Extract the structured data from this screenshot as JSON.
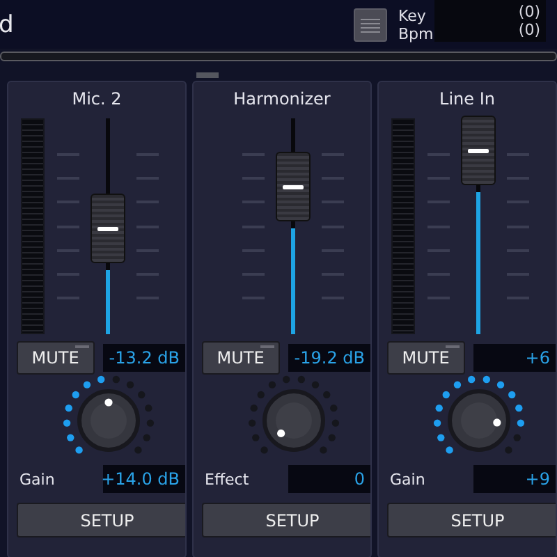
{
  "header": {
    "title": "d",
    "key_label": "Key",
    "key_value": "(0)",
    "bpm_label": "Bpm",
    "bpm_value": "(0)"
  },
  "channels": [
    {
      "name": "Mic. 2",
      "meter": true,
      "level": 0.31,
      "mute_label": "MUTE",
      "muted": false,
      "reading": "-13.2 dB",
      "knob_dots": [
        {
          "on": true
        },
        {
          "on": true
        },
        {
          "on": true
        },
        {
          "on": true
        },
        {
          "on": true
        },
        {
          "on": true
        },
        {
          "on": true
        },
        {
          "on": false
        },
        {
          "on": false
        },
        {
          "on": false
        },
        {
          "on": false
        },
        {
          "on": false
        },
        {
          "on": false
        },
        {
          "on": false
        }
      ],
      "knob_label": "Gain",
      "knob_reading": "+14.0 dB",
      "setup_label": "SETUP"
    },
    {
      "name": "Harmonizer",
      "meter": false,
      "level": 0.51,
      "mute_label": "MUTE",
      "muted": false,
      "reading": "-19.2 dB",
      "knob_dots": [
        {
          "on": false
        },
        {
          "on": false
        },
        {
          "on": false
        },
        {
          "on": false
        },
        {
          "on": false
        },
        {
          "on": false
        },
        {
          "on": false
        },
        {
          "on": false
        },
        {
          "on": false
        },
        {
          "on": false
        },
        {
          "on": false
        },
        {
          "on": false
        },
        {
          "on": false
        },
        {
          "on": false
        }
      ],
      "knob_label": "Effect",
      "knob_reading": "0",
      "setup_label": "SETUP"
    },
    {
      "name": "Line In",
      "meter": true,
      "level": 0.68,
      "mute_label": "MUTE",
      "muted": false,
      "reading": "+6",
      "knob_dots": [
        {
          "on": true
        },
        {
          "on": true
        },
        {
          "on": true
        },
        {
          "on": true
        },
        {
          "on": true
        },
        {
          "on": true
        },
        {
          "on": true
        },
        {
          "on": true
        },
        {
          "on": true
        },
        {
          "on": true
        },
        {
          "on": true
        },
        {
          "on": true
        },
        {
          "on": false
        },
        {
          "on": false
        }
      ],
      "knob_label": "Gain",
      "knob_reading": "+9",
      "setup_label": "SETUP"
    }
  ]
}
